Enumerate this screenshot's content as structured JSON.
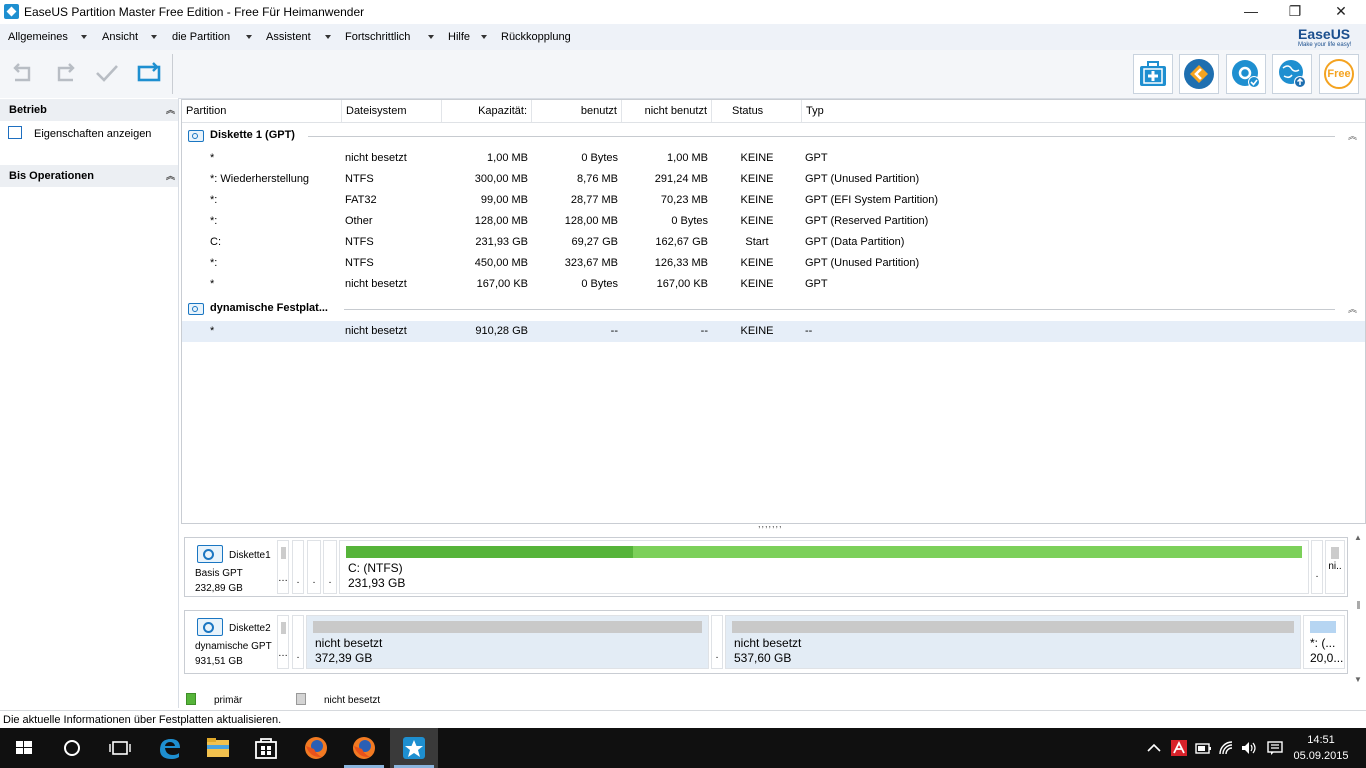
{
  "window": {
    "title": "EaseUS Partition Master Free Edition - Free Für Heimanwender",
    "minimize": "—",
    "restore": "❐",
    "close": "✕"
  },
  "menu": [
    "Allgemeines",
    "Ansicht",
    "die Partition",
    "Assistent",
    "Fortschrittlich",
    "Hilfe",
    "Rückkopplung"
  ],
  "logo": {
    "brand": "EaseUS",
    "tagline": "Make your life easy!"
  },
  "toolbar": {
    "undo_icon": "undo-icon",
    "redo_icon": "redo-icon",
    "apply_icon": "checkmark-icon",
    "refresh_icon": "refresh-icon",
    "free_label": "Free"
  },
  "sidebar": {
    "betrieb": "Betrieb",
    "betrieb_item": "Eigenschaften anzeigen",
    "bis": "Bis Operationen"
  },
  "table": {
    "headers": [
      "Partition",
      "Dateisystem",
      "Kapazität:",
      "benutzt",
      "nicht benutzt",
      "Status",
      "Typ"
    ],
    "groups": [
      {
        "title": "Diskette 1 (GPT)",
        "rows": [
          [
            "*",
            "nicht besetzt",
            "1,00 MB",
            "0 Bytes",
            "1,00 MB",
            "KEINE",
            "GPT"
          ],
          [
            "*: Wiederherstellung",
            "NTFS",
            "300,00 MB",
            "8,76 MB",
            "291,24 MB",
            "KEINE",
            "GPT (Unused Partition)"
          ],
          [
            "*:",
            "FAT32",
            "99,00 MB",
            "28,77 MB",
            "70,23 MB",
            "KEINE",
            "GPT (EFI System Partition)"
          ],
          [
            "*:",
            "Other",
            "128,00 MB",
            "128,00 MB",
            "0 Bytes",
            "KEINE",
            "GPT (Reserved Partition)"
          ],
          [
            "C:",
            "NTFS",
            "231,93 GB",
            "69,27 GB",
            "162,67 GB",
            "Start",
            "GPT (Data Partition)"
          ],
          [
            "*:",
            "NTFS",
            "450,00 MB",
            "323,67 MB",
            "126,33 MB",
            "KEINE",
            "GPT (Unused Partition)"
          ],
          [
            "*",
            "nicht besetzt",
            "167,00 KB",
            "0 Bytes",
            "167,00 KB",
            "KEINE",
            "GPT"
          ]
        ]
      },
      {
        "title": "dynamische Festplat...",
        "rows": [
          [
            "*",
            "nicht besetzt",
            "910,28 GB",
            "--",
            "--",
            "KEINE",
            "--"
          ]
        ]
      }
    ]
  },
  "splitter": ",,,,,,,",
  "disks": [
    {
      "name": "Diskette1",
      "type": "Basis GPT",
      "size": "232,89 GB",
      "tiny_left": [
        "…",
        ".",
        ".",
        "."
      ],
      "main": {
        "label": "C: (NTFS)",
        "size": "231,93 GB",
        "used_fraction": 0.3
      },
      "tiny_right": [
        ".",
        "ni.."
      ]
    },
    {
      "name": "Diskette2",
      "type": "dynamische GPT",
      "size": "931,51 GB",
      "tiny_left": [
        "…",
        "."
      ],
      "segments": [
        {
          "label": "nicht besetzt",
          "size": "372,39 GB"
        },
        {
          "label": "nicht besetzt",
          "size": "537,60 GB"
        }
      ],
      "tiny_mid": ".",
      "last": {
        "l1": "*: (...",
        "l2": "20,0..."
      }
    }
  ],
  "legend": {
    "primary": "primär",
    "unallocated": "nicht besetzt"
  },
  "status": "Die aktuelle Informationen über Festplatten aktualisieren.",
  "taskbar": {
    "time": "14:51",
    "date": "05.09.2015"
  },
  "colors": {
    "accent": "#1e8fd0",
    "primary_fill": "#7cd05a",
    "primary_used": "#56b43a",
    "unalloc": "#c9c9c9"
  }
}
